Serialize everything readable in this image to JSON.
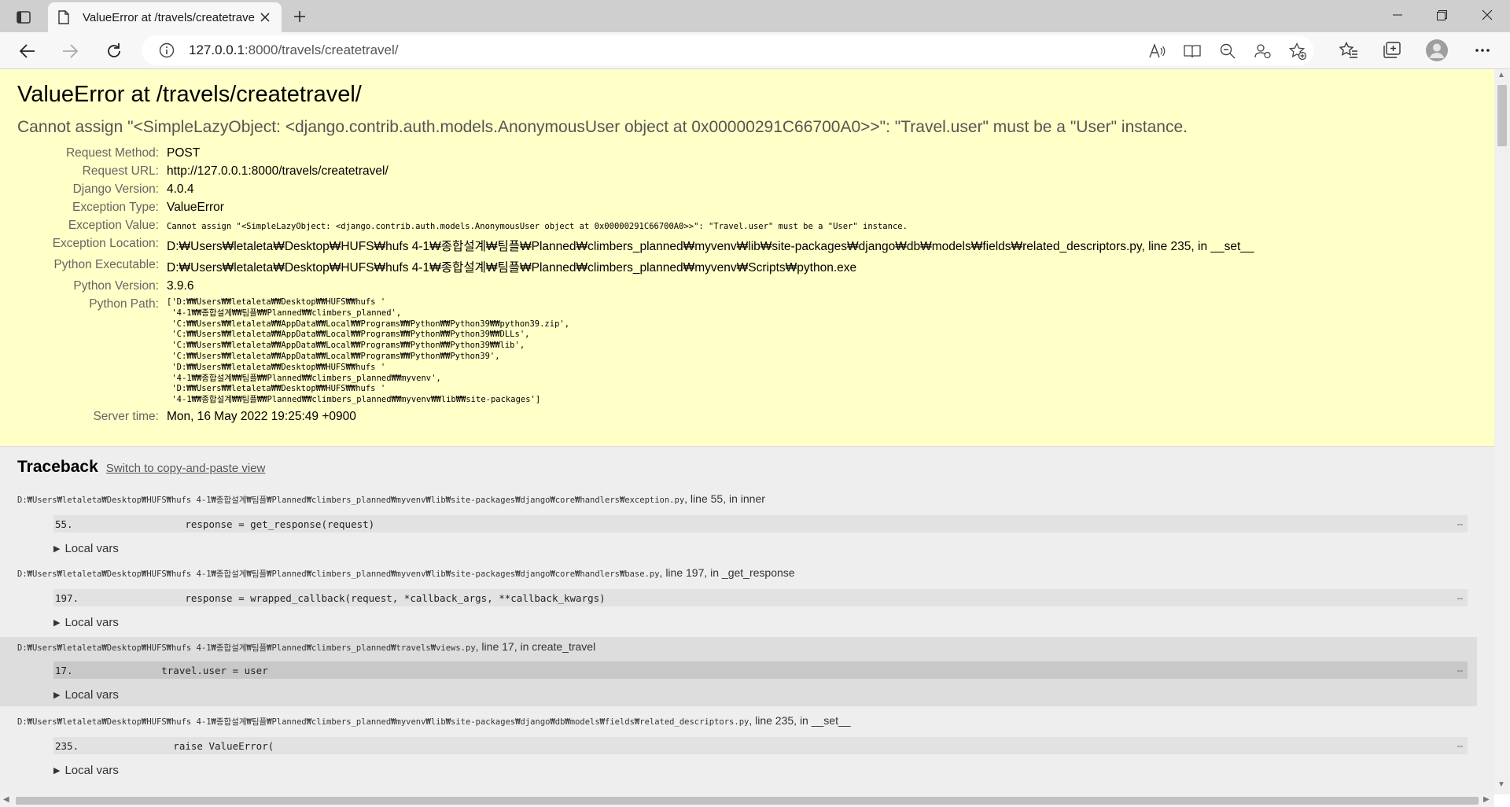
{
  "browser": {
    "tab_title": "ValueError at /travels/createtravel/",
    "url_host": "127.0.0.1",
    "url_rest": ":8000/travels/createtravel/"
  },
  "error": {
    "title": "ValueError at /travels/createtravel/",
    "message": "Cannot assign \"<SimpleLazyObject: <django.contrib.auth.models.AnonymousUser object at 0x00000291C66700A0>>\": \"Travel.user\" must be a \"User\" instance."
  },
  "meta": {
    "request_method_label": "Request Method:",
    "request_method": "POST",
    "request_url_label": "Request URL:",
    "request_url": "http://127.0.0.1:8000/travels/createtravel/",
    "django_version_label": "Django Version:",
    "django_version": "4.0.4",
    "exception_type_label": "Exception Type:",
    "exception_type": "ValueError",
    "exception_value_label": "Exception Value:",
    "exception_value": "Cannot assign \"<SimpleLazyObject: <django.contrib.auth.models.AnonymousUser object at 0x00000291C66700A0>>\": \"Travel.user\" must be a \"User\" instance.",
    "exception_location_label": "Exception Location:",
    "exception_location": "D:₩Users₩letaleta₩Desktop₩HUFS₩hufs 4-1₩종합설계₩팀플₩Planned₩climbers_planned₩myvenv₩lib₩site-packages₩django₩db₩models₩fields₩related_descriptors.py, line 235, in __set__",
    "python_executable_label": "Python Executable:",
    "python_executable": "D:₩Users₩letaleta₩Desktop₩HUFS₩hufs 4-1₩종합설계₩팀플₩Planned₩climbers_planned₩myvenv₩Scripts₩python.exe",
    "python_version_label": "Python Version:",
    "python_version": "3.9.6",
    "python_path_label": "Python Path:",
    "python_path": "['D:₩₩Users₩₩letaleta₩₩Desktop₩₩HUFS₩₩hufs '\n '4-1₩₩종합설계₩₩팀플₩₩Planned₩₩climbers_planned',\n 'C:₩₩Users₩₩letaleta₩₩AppData₩₩Local₩₩Programs₩₩Python₩₩Python39₩₩python39.zip',\n 'C:₩₩Users₩₩letaleta₩₩AppData₩₩Local₩₩Programs₩₩Python₩₩Python39₩₩DLLs',\n 'C:₩₩Users₩₩letaleta₩₩AppData₩₩Local₩₩Programs₩₩Python₩₩Python39₩₩lib',\n 'C:₩₩Users₩₩letaleta₩₩AppData₩₩Local₩₩Programs₩₩Python₩₩Python39',\n 'D:₩₩Users₩₩letaleta₩₩Desktop₩₩HUFS₩₩hufs '\n '4-1₩₩종합설계₩₩팀플₩₩Planned₩₩climbers_planned₩₩myvenv',\n 'D:₩₩Users₩₩letaleta₩₩Desktop₩₩HUFS₩₩hufs '\n '4-1₩₩종합설계₩₩팀플₩₩Planned₩₩climbers_planned₩₩myvenv₩₩lib₩₩site-packages']",
    "server_time_label": "Server time:",
    "server_time": "Mon, 16 May 2022 19:25:49 +0900"
  },
  "traceback": {
    "heading": "Traceback",
    "switch_link": "Switch to copy-and-paste view",
    "local_vars_label": "Local vars",
    "ellipsis": "…",
    "frames": [
      {
        "file": "D:₩Users₩letaleta₩Desktop₩HUFS₩hufs 4-1₩종합설계₩팀플₩Planned₩climbers_planned₩myvenv₩lib₩site-packages₩django₩core₩handlers₩exception.py",
        "where": ", line 55, in inner",
        "lineno": "55.",
        "code": "              response = get_response(request)"
      },
      {
        "file": "D:₩Users₩letaleta₩Desktop₩HUFS₩hufs 4-1₩종합설계₩팀플₩Planned₩climbers_planned₩myvenv₩lib₩site-packages₩django₩core₩handlers₩base.py",
        "where": ", line 197, in _get_response",
        "lineno": "197.",
        "code": "              response = wrapped_callback(request, *callback_args, **callback_kwargs)"
      },
      {
        "file": "D:₩Users₩letaleta₩Desktop₩HUFS₩hufs 4-1₩종합설계₩팀플₩Planned₩climbers_planned₩travels₩views.py",
        "where": ", line 17, in create_travel",
        "lineno": "17.",
        "code": "          travel.user = user"
      },
      {
        "file": "D:₩Users₩letaleta₩Desktop₩HUFS₩hufs 4-1₩종합설계₩팀플₩Planned₩climbers_planned₩myvenv₩lib₩site-packages₩django₩db₩models₩fields₩related_descriptors.py",
        "where": ", line 235, in __set__",
        "lineno": "235.",
        "code": "            raise ValueError("
      }
    ]
  }
}
